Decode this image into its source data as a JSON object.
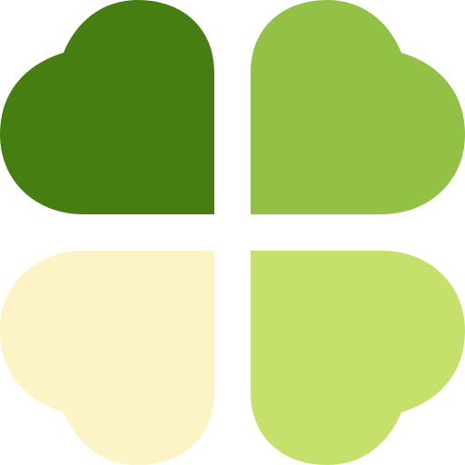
{
  "logo": {
    "icon": "four-leaf-clover-icon",
    "colors": {
      "top_left": "#477E12",
      "top_right": "#92C146",
      "bottom_left": "#FCF3C6",
      "bottom_right": "#C6E06C",
      "background": "#FFFFFF"
    }
  }
}
